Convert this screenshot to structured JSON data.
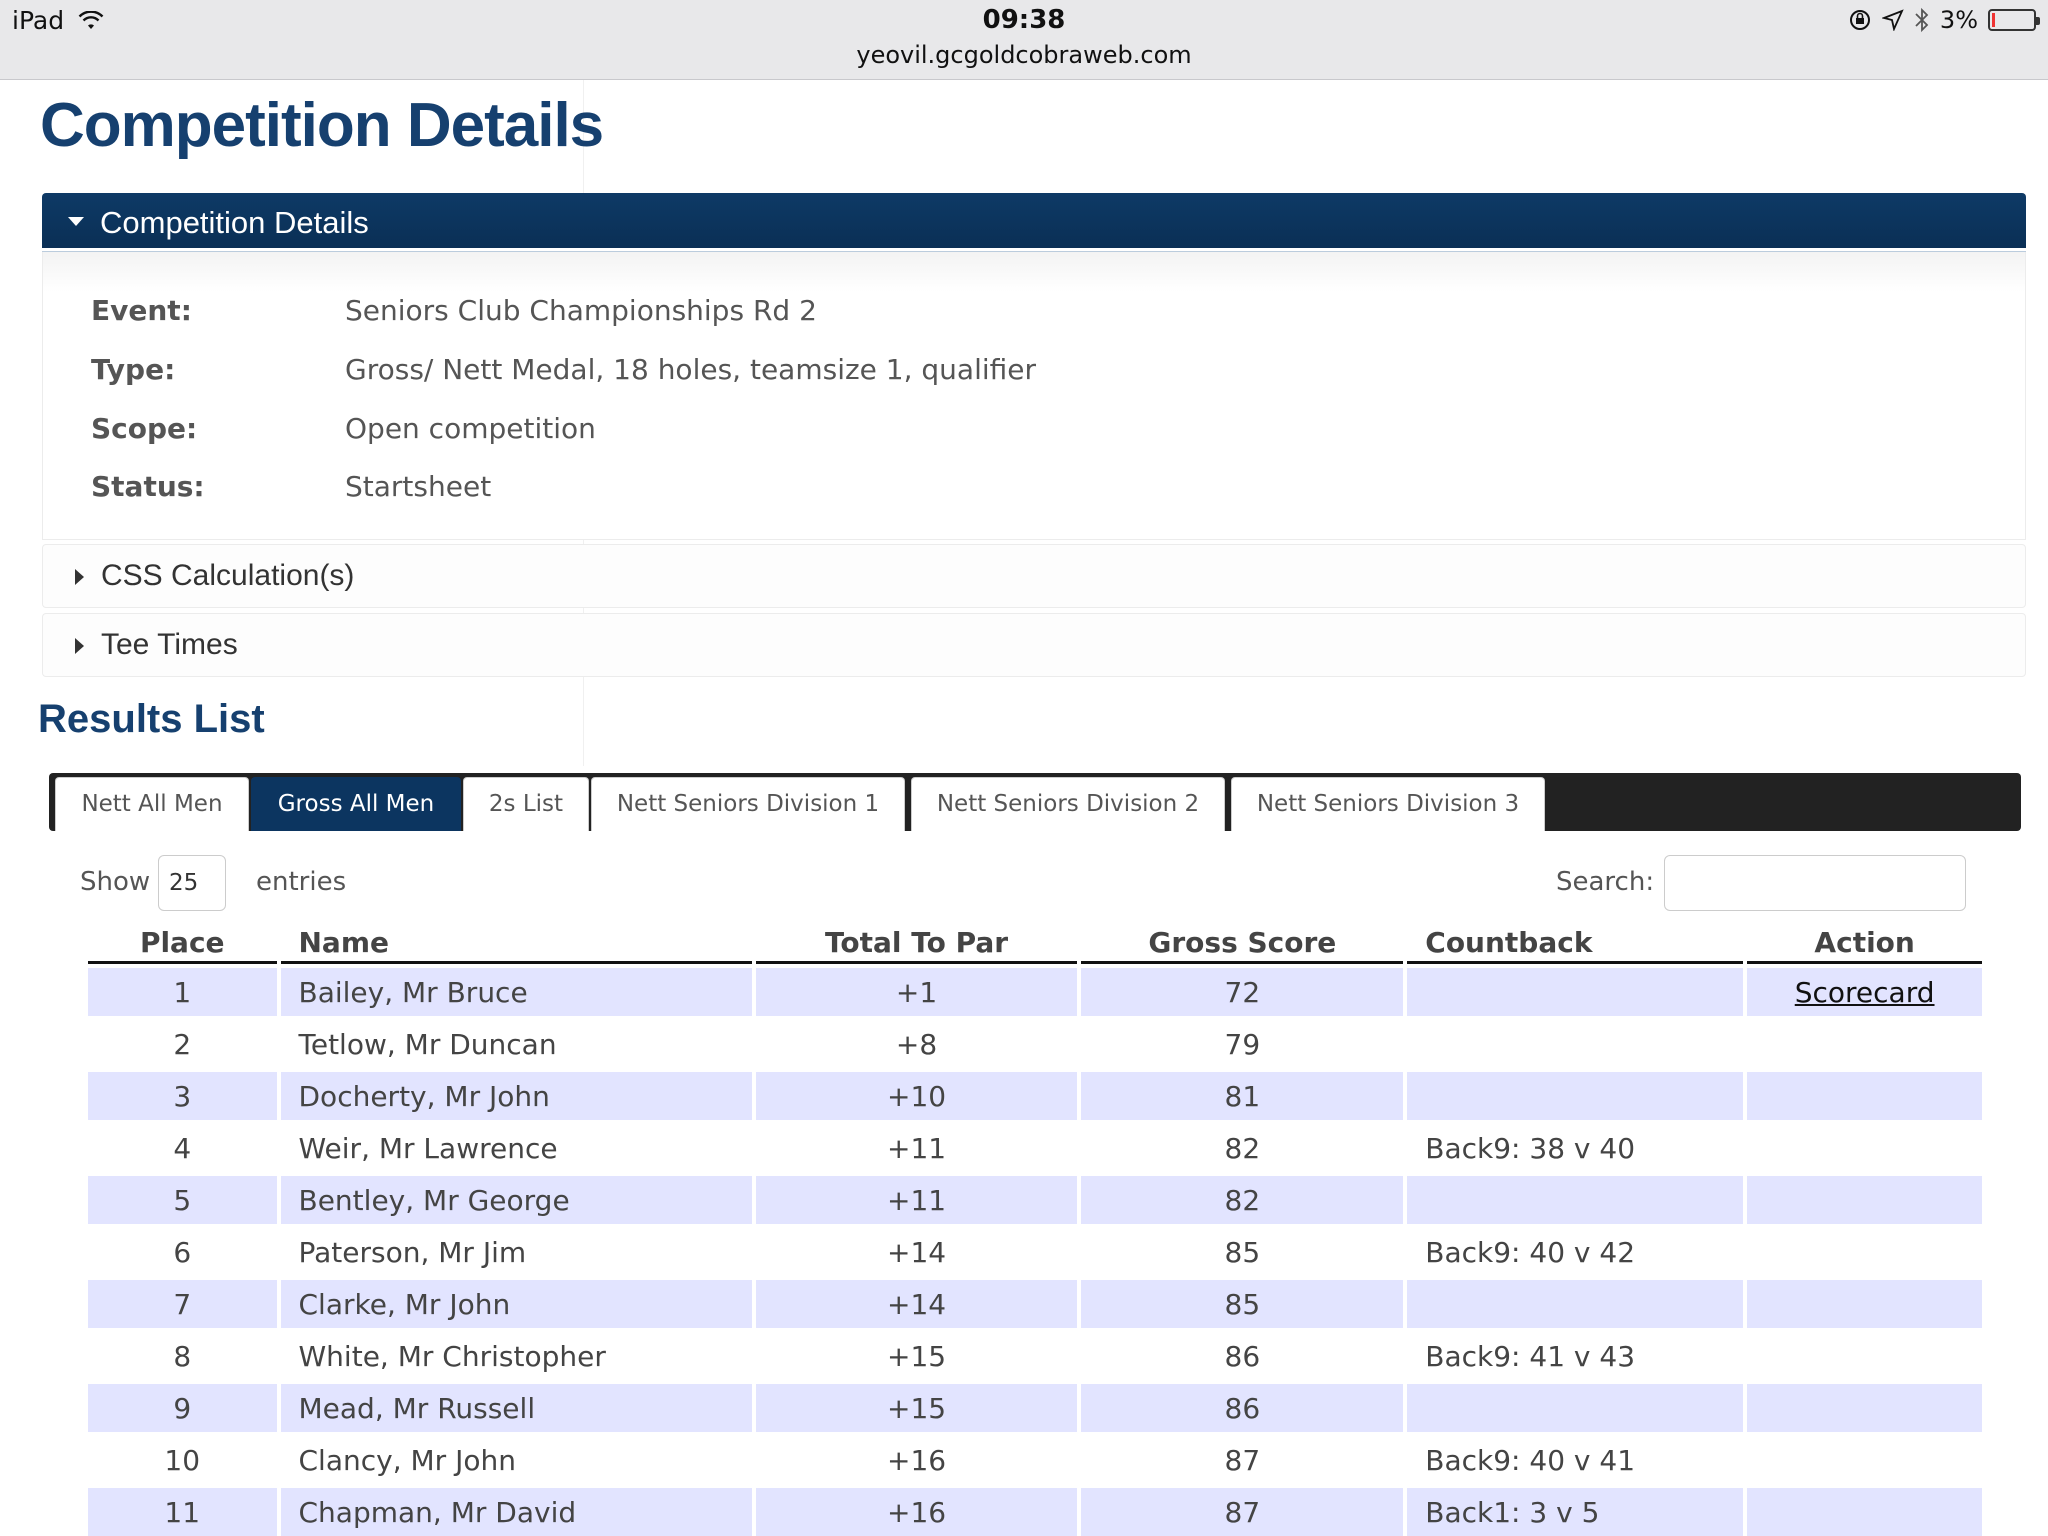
{
  "status_bar": {
    "device": "iPad",
    "time": "09:38",
    "url": "yeovil.gcgoldcobraweb.com",
    "battery": "3%",
    "battery_level": 0.03
  },
  "page": {
    "title": "Competition Details"
  },
  "details_panel": {
    "header": "Competition Details",
    "rows": [
      {
        "label": "Event:",
        "value": "Seniors Club Championships Rd 2"
      },
      {
        "label": "Type:",
        "value": "Gross/ Nett Medal, 18 holes, teamsize 1, qualifier"
      },
      {
        "label": "Scope:",
        "value": "Open competition"
      },
      {
        "label": "Status:",
        "value": "Startsheet"
      }
    ]
  },
  "css_panel": {
    "header": "CSS Calculation(s)"
  },
  "tee_panel": {
    "header": "Tee Times"
  },
  "results": {
    "title": "Results List",
    "tabs": [
      {
        "label": "Nett All Men",
        "active": false
      },
      {
        "label": "Gross All Men",
        "active": true
      },
      {
        "label": "2s List",
        "active": false
      },
      {
        "label": "Nett Seniors Division 1",
        "active": false
      },
      {
        "label": "Nett Seniors Division 2",
        "active": false
      },
      {
        "label": "Nett Seniors Division 3",
        "active": false
      }
    ],
    "show_label": "Show",
    "entries_value": "25",
    "entries_label": "entries",
    "search_label": "Search:",
    "search_value": "",
    "columns": [
      "Place",
      "Name",
      "Total To Par",
      "Gross Score",
      "Countback",
      "Action"
    ],
    "rows": [
      {
        "place": "1",
        "name": "Bailey, Mr Bruce",
        "to_par": "+1",
        "gross": "72",
        "countback": "",
        "action": "Scorecard"
      },
      {
        "place": "2",
        "name": "Tetlow, Mr Duncan",
        "to_par": "+8",
        "gross": "79",
        "countback": "",
        "action": ""
      },
      {
        "place": "3",
        "name": "Docherty, Mr John",
        "to_par": "+10",
        "gross": "81",
        "countback": "",
        "action": ""
      },
      {
        "place": "4",
        "name": "Weir, Mr Lawrence",
        "to_par": "+11",
        "gross": "82",
        "countback": "Back9: 38 v 40",
        "action": ""
      },
      {
        "place": "5",
        "name": "Bentley, Mr George",
        "to_par": "+11",
        "gross": "82",
        "countback": "",
        "action": ""
      },
      {
        "place": "6",
        "name": "Paterson, Mr Jim",
        "to_par": "+14",
        "gross": "85",
        "countback": "Back9: 40 v 42",
        "action": ""
      },
      {
        "place": "7",
        "name": "Clarke, Mr John",
        "to_par": "+14",
        "gross": "85",
        "countback": "",
        "action": ""
      },
      {
        "place": "8",
        "name": "White, Mr Christopher",
        "to_par": "+15",
        "gross": "86",
        "countback": "Back9: 41 v 43",
        "action": ""
      },
      {
        "place": "9",
        "name": "Mead, Mr Russell",
        "to_par": "+15",
        "gross": "86",
        "countback": "",
        "action": ""
      },
      {
        "place": "10",
        "name": "Clancy, Mr John",
        "to_par": "+16",
        "gross": "87",
        "countback": "Back9: 40 v 41",
        "action": ""
      },
      {
        "place": "11",
        "name": "Chapman, Mr David",
        "to_par": "+16",
        "gross": "87",
        "countback": "Back1: 3 v 5",
        "action": ""
      }
    ]
  }
}
